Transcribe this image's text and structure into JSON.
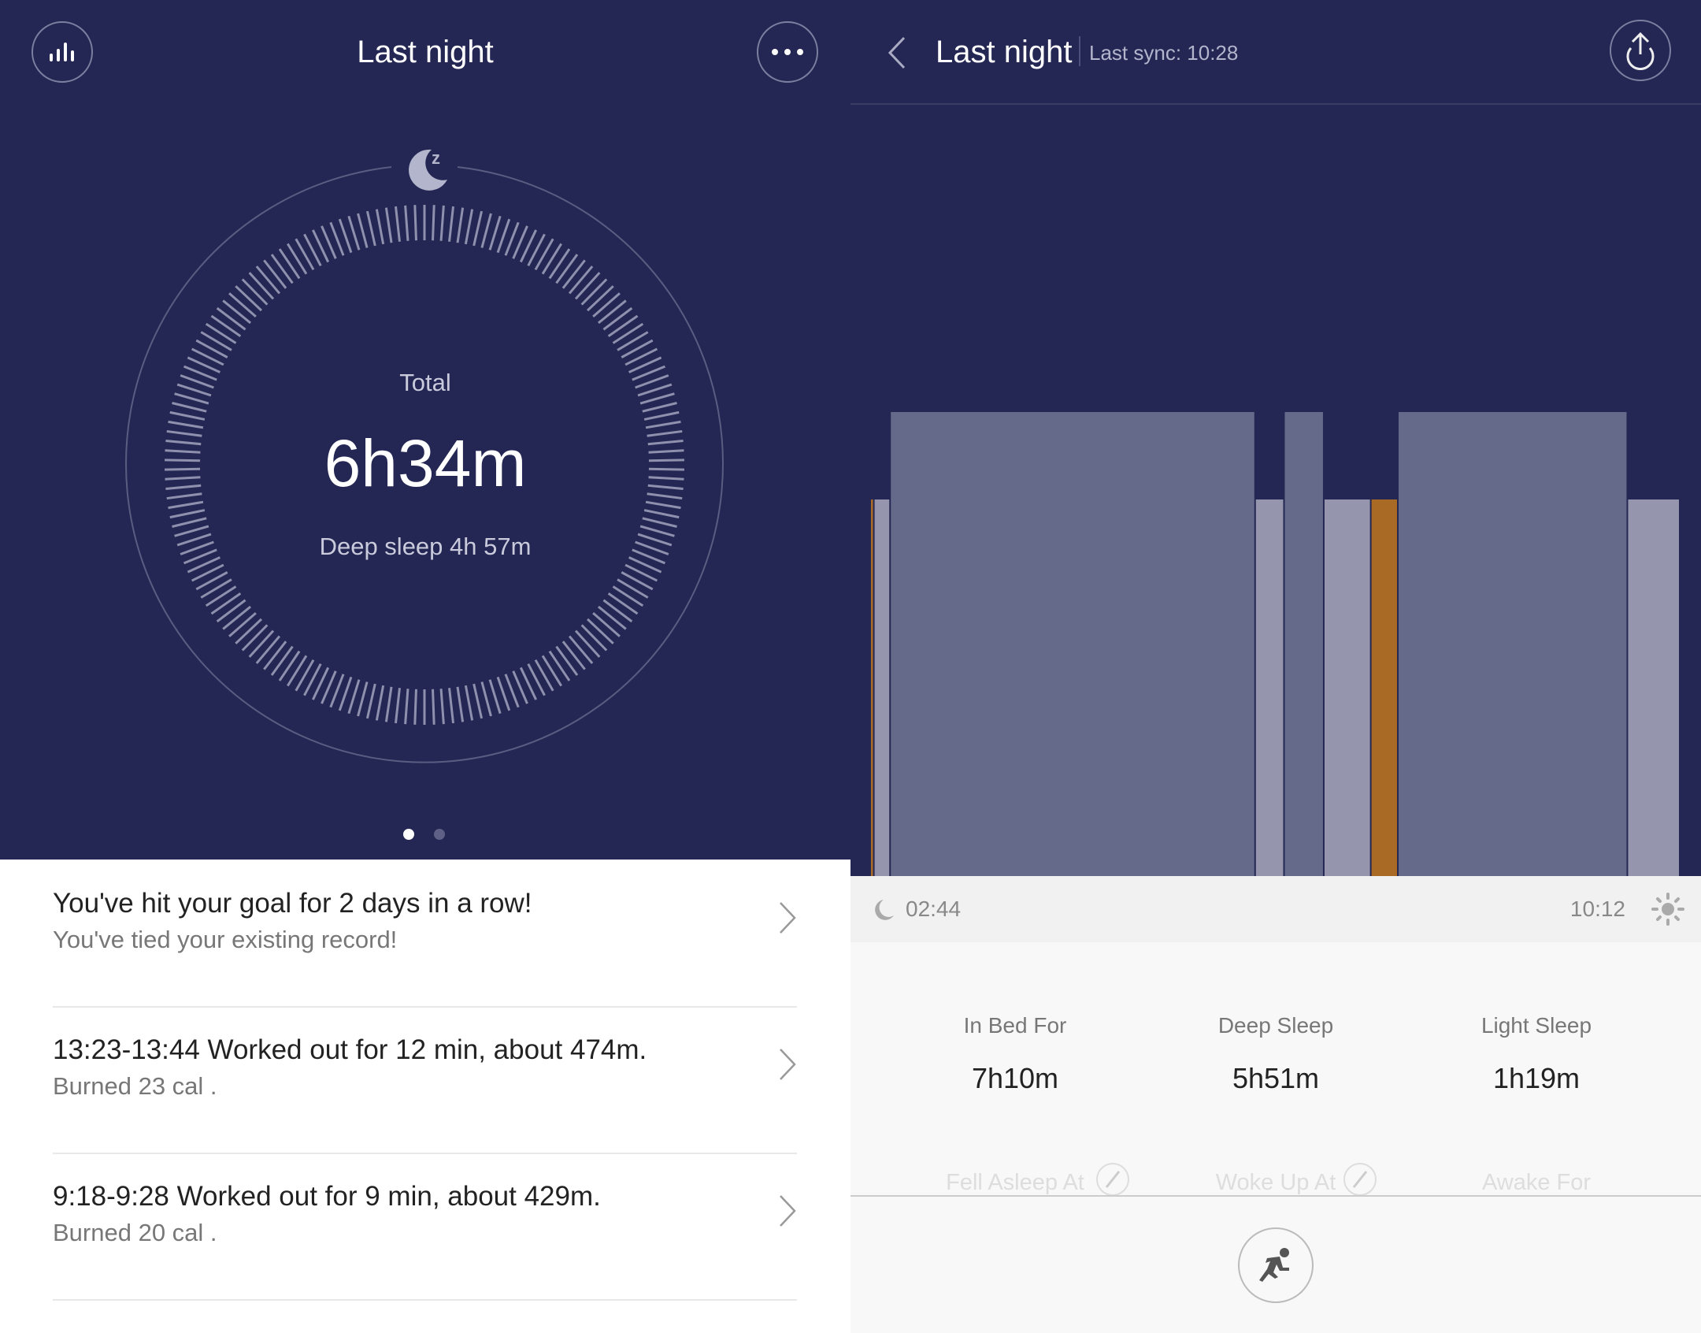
{
  "left": {
    "title": "Last night",
    "icons": {
      "stats": "bar-chart-icon",
      "more": "more-dots-icon",
      "sleep": "moon-zz-icon"
    },
    "ring": {
      "label": "Total",
      "total": "6h34m",
      "deep": "Deep sleep 4h 57m"
    },
    "pager": {
      "count": 2,
      "active": 0
    },
    "items": [
      {
        "title": "You've hit your goal for 2 days in a row!",
        "subtitle": "You've tied your existing record!"
      },
      {
        "title": "13:23-13:44  Worked out for 12 min, about 474m.",
        "subtitle": "Burned 23 cal ."
      },
      {
        "title": "9:18-9:28  Worked out for 9 min, about 429m.",
        "subtitle": "Burned 20 cal ."
      }
    ]
  },
  "right": {
    "title": "Last night",
    "sync": "Last sync: 10:28",
    "start_time": "02:44",
    "end_time": "10:12",
    "stats": [
      {
        "label": "In Bed For",
        "value": "7h10m"
      },
      {
        "label": "Deep Sleep",
        "value": "5h51m"
      },
      {
        "label": "Light Sleep",
        "value": "1h19m"
      }
    ],
    "more_labels": [
      "Fell Asleep At",
      "Woke Up At",
      "Awake For"
    ],
    "icons": {
      "back": "chevron-left-icon",
      "share": "share-upload-icon",
      "start": "moon-icon",
      "end": "sun-icon",
      "workout": "running-man-icon",
      "edit": "pencil-icon"
    }
  },
  "colors": {
    "background": "#242753",
    "deep": "#666a8a",
    "light": "#9596ad",
    "awake": "#a86a24"
  },
  "chart_data": {
    "type": "bar",
    "xlim": [
      "02:44",
      "10:12"
    ],
    "segments": [
      {
        "stage": "awake",
        "start": "02:44",
        "end": "02:46"
      },
      {
        "stage": "light",
        "start": "02:46",
        "end": "02:55"
      },
      {
        "stage": "deep",
        "start": "02:55",
        "end": "06:17"
      },
      {
        "stage": "light",
        "start": "06:17",
        "end": "06:33"
      },
      {
        "stage": "deep",
        "start": "06:33",
        "end": "06:55"
      },
      {
        "stage": "light",
        "start": "06:55",
        "end": "07:21"
      },
      {
        "stage": "awake",
        "start": "07:21",
        "end": "07:36"
      },
      {
        "stage": "deep",
        "start": "07:36",
        "end": "09:43"
      },
      {
        "stage": "light",
        "start": "09:43",
        "end": "10:12"
      }
    ]
  }
}
